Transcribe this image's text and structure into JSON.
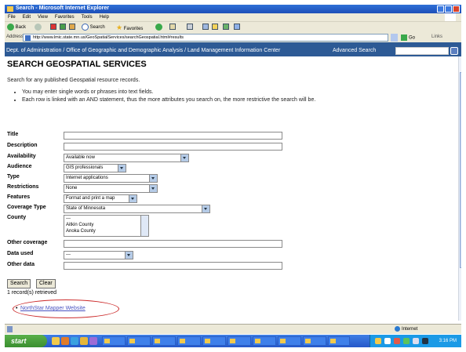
{
  "window": {
    "title": "Search - Microsoft Internet Explorer",
    "menu": [
      "File",
      "Edit",
      "View",
      "Favorites",
      "Tools",
      "Help"
    ]
  },
  "toolbar": {
    "back_label": "Back",
    "search_label": "Search",
    "favorites_label": "Favorites"
  },
  "address": {
    "label": "Address",
    "url": "http://www.lmic.state.mn.us/GeoSpatialServices/searchGeospatial.html#results",
    "go_label": "Go",
    "links_label": "Links"
  },
  "page": {
    "nav_path": "Dept. of Administration / Office of Geographic and Demographic Analysis / Land Management Information Center",
    "advanced_search_label": "Advanced Search",
    "heading": "SEARCH GEOSPATIAL SERVICES",
    "intro": "Search for any published Geospatial resource records.",
    "bullets": [
      "You may enter single words or phrases into text fields.",
      "Each row is linked with an AND statement, thus the more attributes you search on, the more restrictive the search will be."
    ]
  },
  "form": {
    "title_label": "Title",
    "description_label": "Description",
    "availability_label": "Availability",
    "availability_value": "Available now",
    "audience_label": "Audience",
    "audience_value": "GIS professionals",
    "type_label": "Type",
    "type_value": "Internet applications",
    "restrictions_label": "Restrictions",
    "restrictions_value": "None",
    "features_label": "Features",
    "features_value": "Format and print a map",
    "coverage_type_label": "Coverage Type",
    "coverage_type_value": "State of Minnesota",
    "county_label": "County",
    "county_options": [
      "---",
      "Aitkin County",
      "Anoka County"
    ],
    "other_coverage_label": "Other coverage",
    "data_used_label": "Data used",
    "data_used_value": "---",
    "other_data_label": "Other data",
    "search_button": "Search",
    "clear_button": "Clear"
  },
  "results": {
    "count_text": "1 record(s) retrieved",
    "items": [
      "NorthStar Mapper Website"
    ]
  },
  "status": {
    "zone": "Internet"
  },
  "taskbar": {
    "start_label": "start",
    "clock": "3:16 PM"
  }
}
